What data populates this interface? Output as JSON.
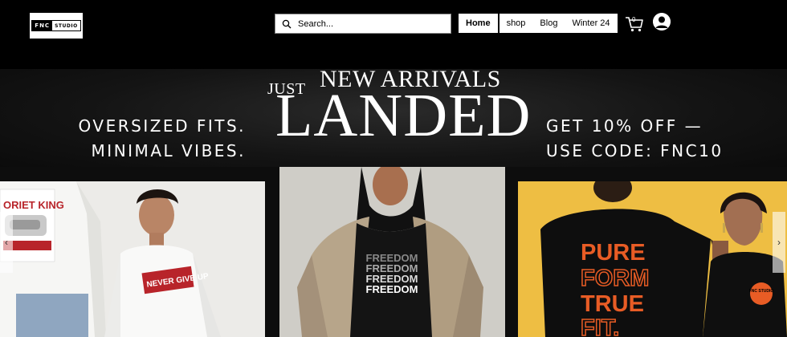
{
  "logo": {
    "fnc": "FNC",
    "studio": "STUDIO"
  },
  "search": {
    "placeholder": "Search..."
  },
  "nav": {
    "items": [
      "Home",
      "shop",
      "Blog",
      "Winter 24"
    ]
  },
  "cart": {
    "count": "0"
  },
  "banner": {
    "left_line1": "OVERSIZED FITS.",
    "left_line2": "MINIMAL VIBES.",
    "just": "JUST",
    "new_arrivals": "NEW ARRIVALS",
    "landed": "LANDED",
    "right_line1": "GET 10% OFF —",
    "right_line2": "USE CODE: FNC10"
  },
  "products": {
    "card1": {
      "print_top": "ORIET KING",
      "print_mid": "NEVER GIVE UP"
    },
    "card2": {
      "print_lines": [
        "FREEDOM",
        "FREEDOM",
        "FREEDOM",
        "FREEDOM"
      ]
    },
    "card3": {
      "print_lines": [
        "PURE",
        "FORM",
        "TRUE",
        "FIT."
      ],
      "badge": "FNC STUDIO"
    }
  },
  "icons": {
    "search": "search-icon",
    "cart": "cart-icon",
    "account": "account-icon",
    "prev": "chevron-left-icon",
    "next": "chevron-right-icon"
  },
  "colors": {
    "header_bg": "#000000",
    "accent_orange": "#e85c25",
    "yellow_bg": "#eebe43"
  }
}
